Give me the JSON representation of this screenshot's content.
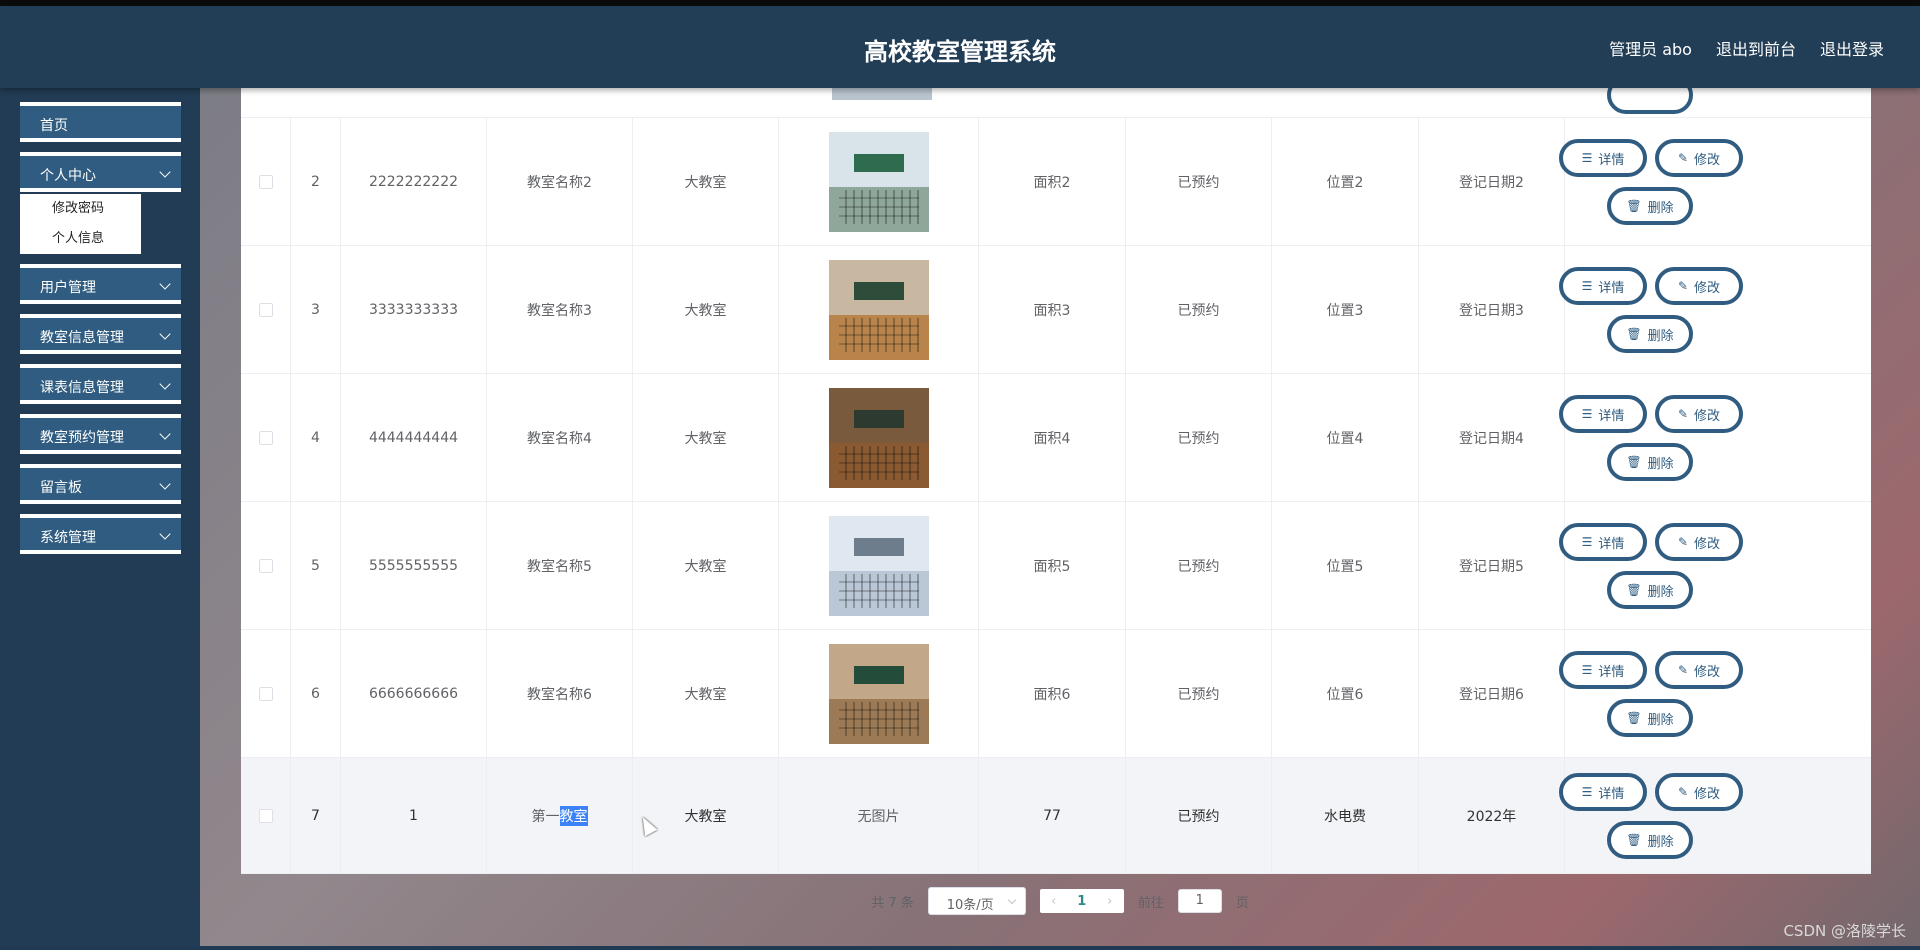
{
  "header": {
    "title": "高校教室管理系统",
    "admin": "管理员 abo",
    "to_front": "退出到前台",
    "logout": "退出登录"
  },
  "sidebar": {
    "items": [
      {
        "label": "首页"
      },
      {
        "label": "个人中心"
      },
      {
        "label": "用户管理"
      },
      {
        "label": "教室信息管理"
      },
      {
        "label": "课表信息管理"
      },
      {
        "label": "教室预约管理"
      },
      {
        "label": "留言板"
      },
      {
        "label": "系统管理"
      }
    ],
    "submenu": [
      "修改密码",
      "个人信息"
    ]
  },
  "table": {
    "rows": [
      {
        "idx": "2",
        "code": "2222222222",
        "name": "教室名称2",
        "type": "大教室",
        "image": "photo",
        "area": "面积2",
        "status": "已预约",
        "location": "位置2",
        "date": "登记日期2"
      },
      {
        "idx": "3",
        "code": "3333333333",
        "name": "教室名称3",
        "type": "大教室",
        "image": "photo",
        "area": "面积3",
        "status": "已预约",
        "location": "位置3",
        "date": "登记日期3"
      },
      {
        "idx": "4",
        "code": "4444444444",
        "name": "教室名称4",
        "type": "大教室",
        "image": "photo",
        "area": "面积4",
        "status": "已预约",
        "location": "位置4",
        "date": "登记日期4"
      },
      {
        "idx": "5",
        "code": "5555555555",
        "name": "教室名称5",
        "type": "大教室",
        "image": "photo",
        "area": "面积5",
        "status": "已预约",
        "location": "位置5",
        "date": "登记日期5"
      },
      {
        "idx": "6",
        "code": "6666666666",
        "name": "教室名称6",
        "type": "大教室",
        "image": "photo",
        "area": "面积6",
        "status": "已预约",
        "location": "位置6",
        "date": "登记日期6"
      },
      {
        "idx": "7",
        "code": "1",
        "name_plain": "第一",
        "name_selected": "教室",
        "type": "大教室",
        "image_text": "无图片",
        "area": "77",
        "status": "已预约",
        "location": "水电费",
        "date": "2022年"
      }
    ],
    "actions": {
      "detail": "详情",
      "edit": "修改",
      "delete": "删除"
    }
  },
  "pager": {
    "total": "共 7 条",
    "page_size": "10条/页",
    "current": "1",
    "goto_label": "前往",
    "goto_value": "1",
    "page_suffix": "页"
  },
  "watermark": "CSDN @洛陵学长",
  "colors": {
    "header": "#223e56",
    "sidebar": "#213c54",
    "menu": "#2f5c80",
    "button_border": "#2f5c80"
  }
}
